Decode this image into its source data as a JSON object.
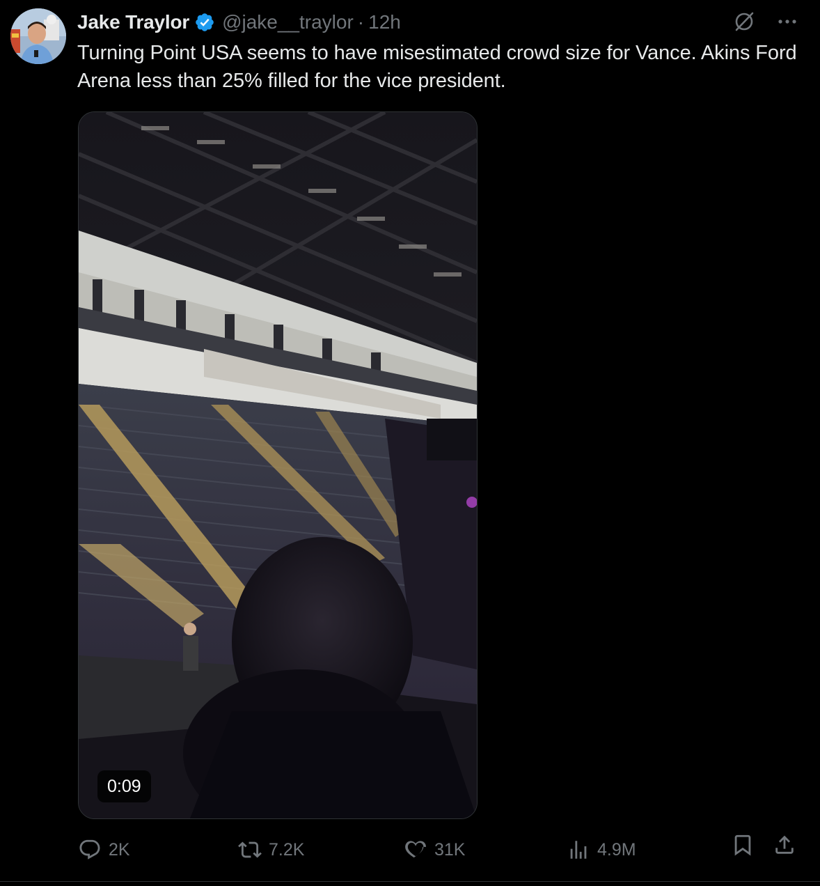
{
  "author": {
    "name": "Jake Traylor",
    "handle": "@jake__traylor",
    "separator": "·",
    "time": "12h"
  },
  "tweet": {
    "text": "Turning Point USA seems to have misestimated crowd size for Vance. Akins Ford Arena less than 25% filled for the vice president."
  },
  "video": {
    "timestamp": "0:09"
  },
  "metrics": {
    "replies": "2K",
    "reposts": "7.2K",
    "likes": "31K",
    "views": "4.9M"
  },
  "colors": {
    "background": "#000000",
    "text": "#e7e9ea",
    "muted": "#71767b",
    "verified": "#1d9bf0",
    "border": "#2f3336"
  },
  "icons": [
    "verified-badge-icon",
    "grok-icon",
    "more-icon",
    "reply-icon",
    "repost-icon",
    "like-icon",
    "views-icon",
    "bookmark-icon",
    "share-icon"
  ]
}
